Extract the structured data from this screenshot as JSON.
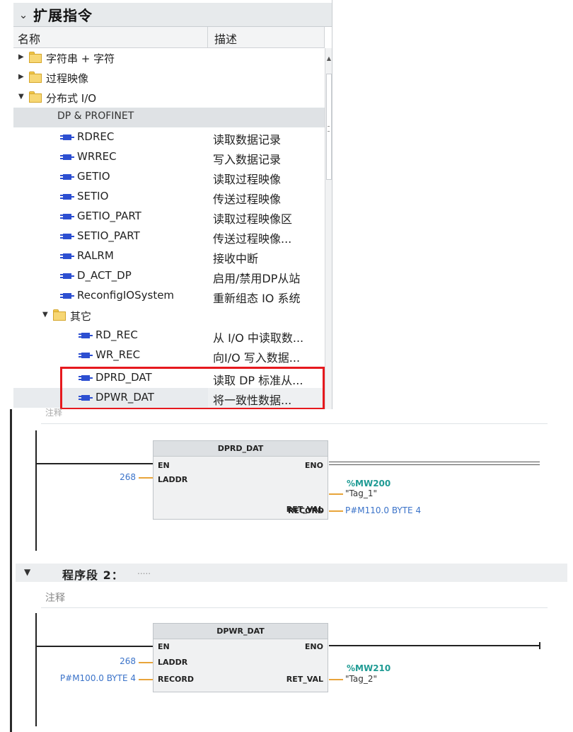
{
  "tree": {
    "title": "扩展指令",
    "columns": {
      "name": "名称",
      "description": "描述"
    },
    "folders": {
      "string": "字符串 + 字符",
      "process_image": "过程映像",
      "distributed_io": "分布式 I/O",
      "others": "其它"
    },
    "group_label": "DP & PROFINET",
    "instructions": [
      {
        "name": "RDREC",
        "description": "读取数据记录"
      },
      {
        "name": "WRREC",
        "description": "写入数据记录"
      },
      {
        "name": "GETIO",
        "description": "读取过程映像"
      },
      {
        "name": "SETIO",
        "description": "传送过程映像"
      },
      {
        "name": "GETIO_PART",
        "description": "读取过程映像区"
      },
      {
        "name": "SETIO_PART",
        "description": "传送过程映像..."
      },
      {
        "name": "RALRM",
        "description": "接收中断"
      },
      {
        "name": "D_ACT_DP",
        "description": "启用/禁用DP从站"
      },
      {
        "name": "ReconfigIOSystem",
        "description": "重新组态 IO 系统"
      }
    ],
    "other_instructions": [
      {
        "name": "RD_REC",
        "description": "从 I/O 中读取数..."
      },
      {
        "name": "WR_REC",
        "description": "向I/O 写入数据..."
      },
      {
        "name": "DPRD_DAT",
        "description": "读取 DP 标准从..."
      },
      {
        "name": "DPWR_DAT",
        "description": "将一致性数据..."
      }
    ]
  },
  "network1": {
    "comment": "注释",
    "block": {
      "title": "DPRD_DAT",
      "en": "EN",
      "eno": "ENO",
      "laddr_label": "LADDR",
      "laddr_value": "268",
      "ret_val_label": "RET_VAL",
      "ret_val_addr": "%MW200",
      "ret_val_tag": "\"Tag_1\"",
      "record_label": "RECORD",
      "record_value": "P#M110.0 BYTE 4"
    }
  },
  "network2": {
    "title": "程序段 2：",
    "dots": ".....",
    "comment": "注释",
    "block": {
      "title": "DPWR_DAT",
      "en": "EN",
      "eno": "ENO",
      "laddr_label": "LADDR",
      "laddr_value": "268",
      "record_label": "RECORD",
      "record_value": "P#M100.0 BYTE 4",
      "ret_val_label": "RET_VAL",
      "ret_val_addr": "%MW210",
      "ret_val_tag": "\"Tag_2\""
    }
  },
  "colors": {
    "highlight_box": "#e6191e",
    "block_icon": "#2d4fd1",
    "address": "#1f9b94",
    "parameter": "#3b73c9",
    "wire_stub": "#e8a43a"
  }
}
